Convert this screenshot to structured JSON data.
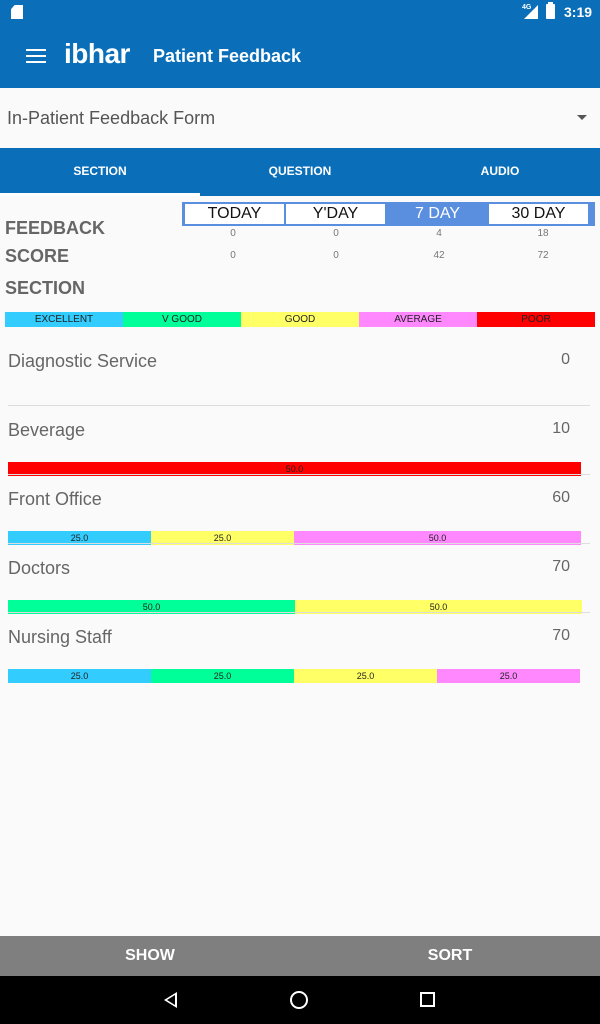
{
  "status_bar": {
    "network": "4G",
    "time": "3:19",
    "icons": [
      "sd-card-icon",
      "signal-icon",
      "battery-icon"
    ]
  },
  "app_bar": {
    "logo": "ibhar",
    "title": "Patient Feedback",
    "menu_icon": "hamburger-menu-icon"
  },
  "form_selector": {
    "value": "In-Patient Feedback Form"
  },
  "tabs": [
    {
      "label": "SECTION",
      "active": true
    },
    {
      "label": "QUESTION",
      "active": false
    },
    {
      "label": "AUDIO",
      "active": false
    }
  ],
  "summary": {
    "feedback_label": "FEEDBACK",
    "score_label": "SCORE",
    "section_label": "SECTION",
    "periods": [
      {
        "label": "TODAY",
        "active": false,
        "feedback": "0",
        "score": "0"
      },
      {
        "label": "Y'DAY",
        "active": false,
        "feedback": "0",
        "score": "0"
      },
      {
        "label": "7 DAY",
        "active": true,
        "feedback": "4",
        "score": "42"
      },
      {
        "label": "30 DAY",
        "active": false,
        "feedback": "18",
        "score": "72"
      }
    ]
  },
  "legend": [
    {
      "label": "EXCELLENT",
      "color": "#33ccff"
    },
    {
      "label": "V GOOD",
      "color": "#00ff99"
    },
    {
      "label": "GOOD",
      "color": "#ffff66"
    },
    {
      "label": "AVERAGE",
      "color": "#ff88ff"
    },
    {
      "label": "POOR",
      "color": "#ff0000"
    }
  ],
  "sections": [
    {
      "name": "Diagnostic Service",
      "score": "0",
      "segments": []
    },
    {
      "name": "Beverage",
      "score": "10",
      "segments": [
        {
          "rating": "POOR",
          "value": 50.0,
          "label": "50.0"
        }
      ]
    },
    {
      "name": "Front Office",
      "score": "60",
      "segments": [
        {
          "rating": "EXCELLENT",
          "value": 25.0,
          "label": "25.0"
        },
        {
          "rating": "GOOD",
          "value": 25.0,
          "label": "25.0"
        },
        {
          "rating": "AVERAGE",
          "value": 50.0,
          "label": "50.0"
        }
      ]
    },
    {
      "name": "Doctors",
      "score": "70",
      "segments": [
        {
          "rating": "V GOOD",
          "value": 50.0,
          "label": "50.0"
        },
        {
          "rating": "GOOD",
          "value": 50.0,
          "label": "50.0"
        }
      ]
    },
    {
      "name": "Nursing Staff",
      "score": "70",
      "segments": [
        {
          "rating": "EXCELLENT",
          "value": 25.0,
          "label": "25.0"
        },
        {
          "rating": "V GOOD",
          "value": 25.0,
          "label": "25.0"
        },
        {
          "rating": "GOOD",
          "value": 25.0,
          "label": "25.0"
        },
        {
          "rating": "AVERAGE",
          "value": 25.0,
          "label": "25.0"
        }
      ]
    }
  ],
  "bottom_buttons": {
    "show": "SHOW",
    "sort": "SORT"
  },
  "nav_icons": [
    "back-icon",
    "home-icon",
    "recents-icon"
  ]
}
